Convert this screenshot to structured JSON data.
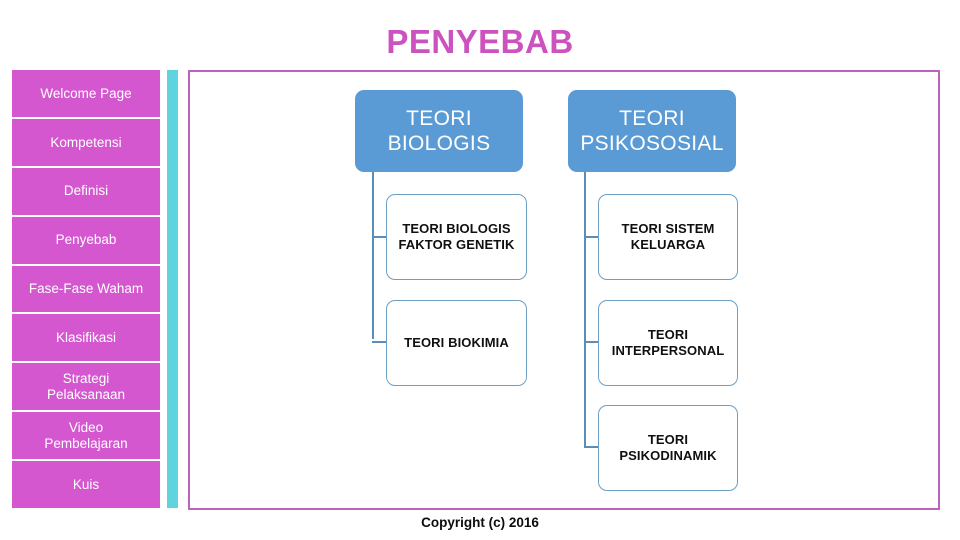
{
  "slide": {
    "title": "PENYEBAB",
    "title_color": "#cc52c0",
    "footer": "Copyright (c) 2016"
  },
  "sidebar": {
    "accent_color": "#5fd3de",
    "button_color": "#d557d0",
    "items": [
      {
        "label": "Welcome Page"
      },
      {
        "label": "Kompetensi"
      },
      {
        "label": "Definisi"
      },
      {
        "label": "Penyebab"
      },
      {
        "label": "Fase-Fase Waham"
      },
      {
        "label": "Klasifikasi"
      },
      {
        "label": "Strategi\nPelaksanaan"
      },
      {
        "label": "Video\nPembelajaran"
      },
      {
        "label": "Kuis"
      }
    ]
  },
  "content": {
    "frame_border_color": "#bd63bd",
    "diagram": {
      "root_fill": "#5b9bd5",
      "leaf_border": "#6c9fc4",
      "connector_color": "#5b8db8",
      "columns": [
        {
          "root": "TEORI\nBIOLOGIS",
          "children": [
            "TEORI BIOLOGIS\nFAKTOR GENETIK",
            "TEORI BIOKIMIA"
          ]
        },
        {
          "root": "TEORI\nPSIKOSOSIAL",
          "children": [
            "TEORI SISTEM\nKELUARGA",
            "TEORI\nINTERPERSONAL",
            "TEORI\nPSIKODINAMIK"
          ]
        }
      ]
    }
  }
}
